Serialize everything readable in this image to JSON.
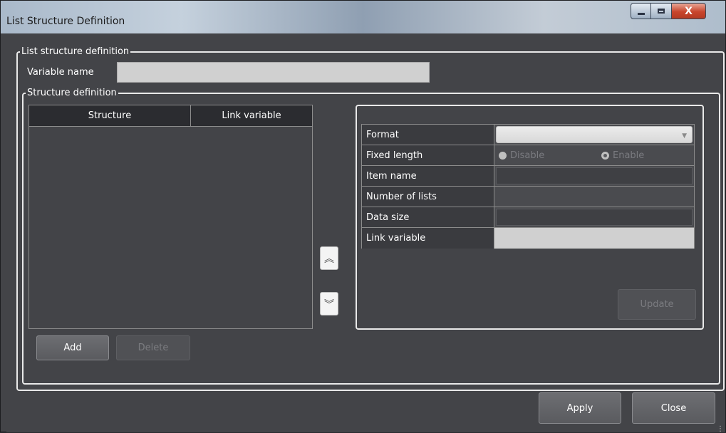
{
  "window": {
    "title": "List Structure Definition",
    "min_icon": "minimize-icon",
    "max_icon": "maximize-icon",
    "close_glyph": "X"
  },
  "list_structure": {
    "legend": "List structure definition",
    "variable_name_label": "Variable name",
    "variable_name_value": ""
  },
  "structure_definition": {
    "legend": "Structure definition",
    "columns": [
      "Structure",
      "Link variable"
    ],
    "rows": [],
    "add_label": "Add",
    "delete_label": "Delete",
    "move_up_glyph": "︽",
    "move_down_glyph": "︾"
  },
  "properties": {
    "rows": [
      {
        "name": "Format",
        "value": ""
      },
      {
        "name": "Fixed length",
        "value": ""
      },
      {
        "name": "Item name",
        "value": ""
      },
      {
        "name": "Number of lists",
        "value": ""
      },
      {
        "name": "Data size",
        "value": ""
      },
      {
        "name": "Link variable",
        "value": ""
      }
    ],
    "fixed_length_options": [
      {
        "label": "Disable",
        "checked": false
      },
      {
        "label": "Enable",
        "checked": true
      }
    ],
    "update_label": "Update"
  },
  "footer": {
    "apply_label": "Apply",
    "close_label": "Close"
  },
  "colors": {
    "window_bg": "#434448",
    "border": "#e9e9e9",
    "disabled_text": "#7b7c80"
  }
}
